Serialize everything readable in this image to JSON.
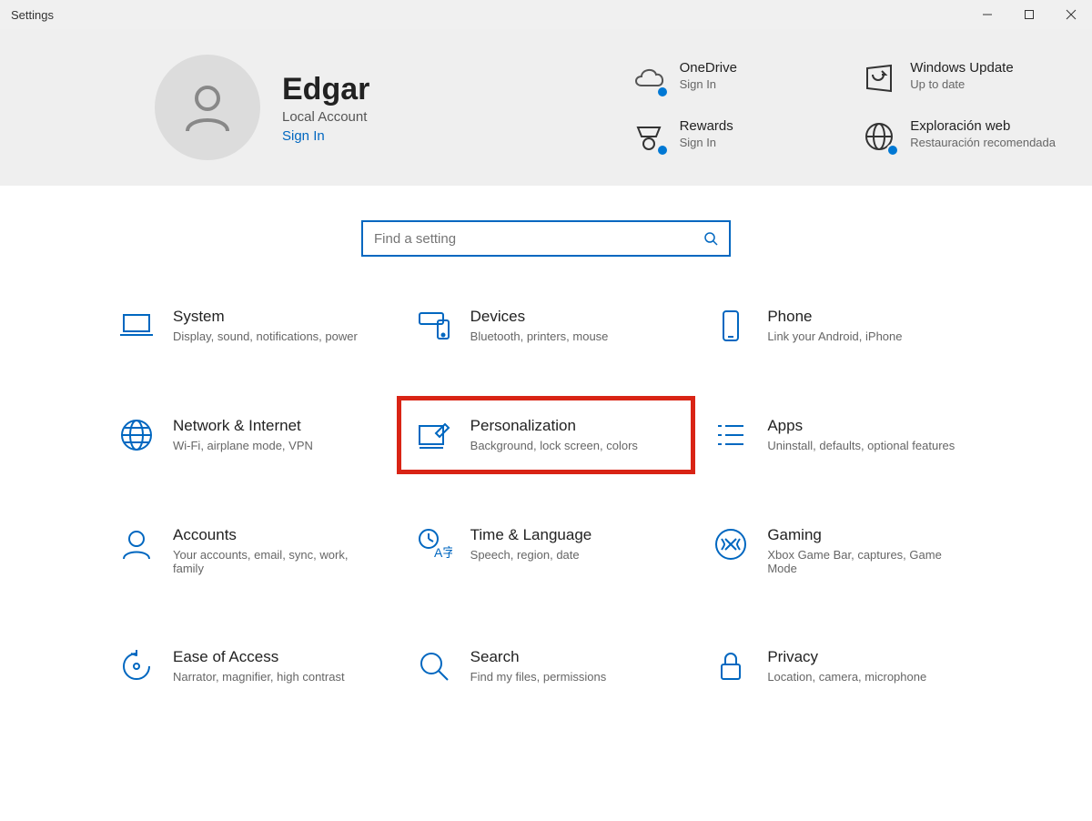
{
  "window_title": "Settings",
  "user": {
    "name": "Edgar",
    "subtitle": "Local Account",
    "signin": "Sign In"
  },
  "status": {
    "0": {
      "title": "OneDrive",
      "sub": "Sign In"
    },
    "1": {
      "title": "Windows Update",
      "sub": "Up to date"
    },
    "2": {
      "title": "Rewards",
      "sub": "Sign In"
    },
    "3": {
      "title": "Exploración web",
      "sub": "Restauración recomendada"
    }
  },
  "search": {
    "placeholder": "Find a setting"
  },
  "categories": {
    "system": {
      "title": "System",
      "desc": "Display, sound, notifications, power"
    },
    "devices": {
      "title": "Devices",
      "desc": "Bluetooth, printers, mouse"
    },
    "phone": {
      "title": "Phone",
      "desc": "Link your Android, iPhone"
    },
    "network": {
      "title": "Network & Internet",
      "desc": "Wi-Fi, airplane mode, VPN"
    },
    "personalization": {
      "title": "Personalization",
      "desc": "Background, lock screen, colors"
    },
    "apps": {
      "title": "Apps",
      "desc": "Uninstall, defaults, optional features"
    },
    "accounts": {
      "title": "Accounts",
      "desc": "Your accounts, email, sync, work, family"
    },
    "time": {
      "title": "Time & Language",
      "desc": "Speech, region, date"
    },
    "gaming": {
      "title": "Gaming",
      "desc": "Xbox Game Bar, captures, Game Mode"
    },
    "ease": {
      "title": "Ease of Access",
      "desc": "Narrator, magnifier, high contrast"
    },
    "search": {
      "title": "Search",
      "desc": "Find my files, permissions"
    },
    "privacy": {
      "title": "Privacy",
      "desc": "Location, camera, microphone"
    }
  },
  "colors": {
    "accent": "#0067c0",
    "highlight": "#d92415"
  }
}
